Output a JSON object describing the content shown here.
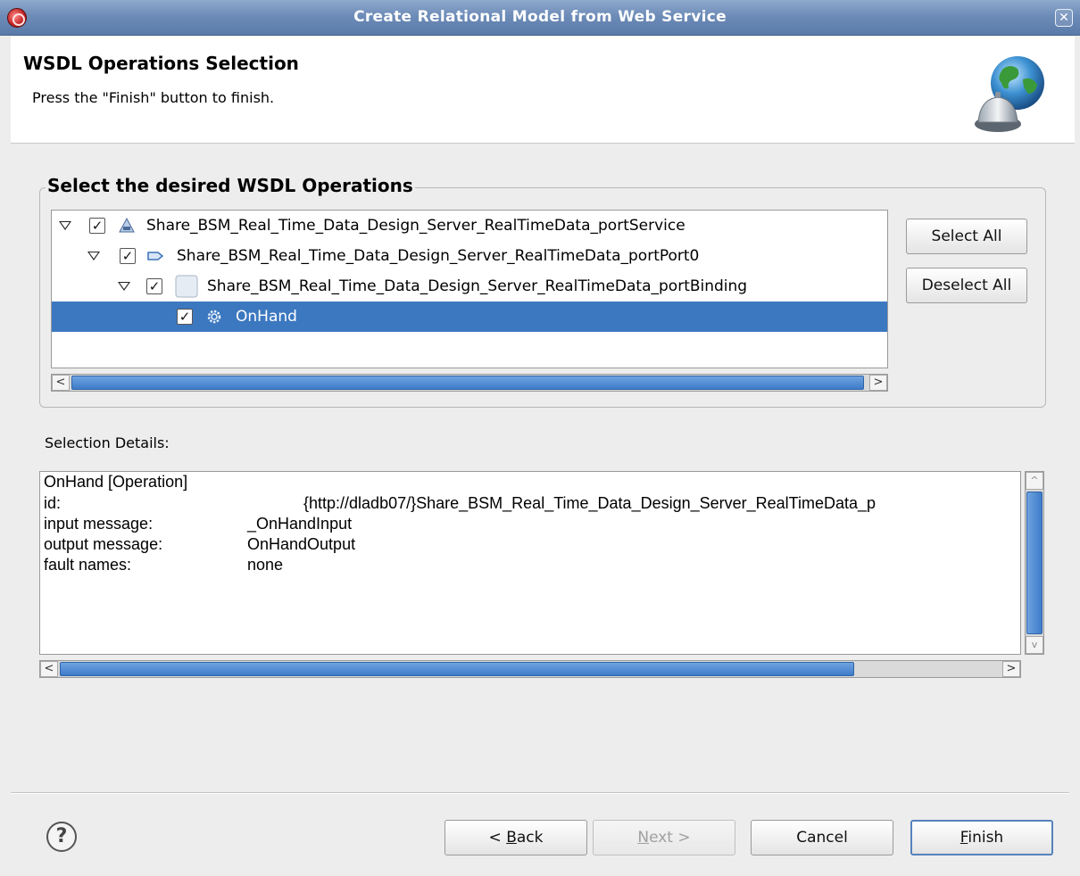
{
  "window": {
    "title": "Create Relational Model from Web Service",
    "close_glyph": "✕",
    "icon": "app-icon"
  },
  "header": {
    "title": "WSDL Operations Selection",
    "description": "Press the \"Finish\" button to finish.",
    "icon": "globe-service-bell-icon"
  },
  "operations_group": {
    "legend": "Select the desired WSDL Operations",
    "tree": [
      {
        "label": "Share_BSM_Real_Time_Data_Design_Server_RealTimeData_portService",
        "checked": true,
        "expanded": true,
        "icon": "service-icon"
      },
      {
        "label": "Share_BSM_Real_Time_Data_Design_Server_RealTimeData_portPort0",
        "checked": true,
        "expanded": true,
        "icon": "port-icon"
      },
      {
        "label": "Share_BSM_Real_Time_Data_Design_Server_RealTimeData_portBinding",
        "checked": true,
        "expanded": true,
        "icon": "binding-icon"
      },
      {
        "label": "OnHand",
        "checked": true,
        "selected": true,
        "icon": "operation-gear-icon"
      }
    ],
    "check_glyph": "✓",
    "select_all": "Select All",
    "deselect_all": "Deselect All"
  },
  "details": {
    "label": "Selection Details:",
    "heading": "OnHand [Operation]",
    "rows": [
      {
        "key": "id:",
        "value": "{http://dladb07/}Share_BSM_Real_Time_Data_Design_Server_RealTimeData_p"
      },
      {
        "key": "input message:",
        "value": "_OnHandInput"
      },
      {
        "key": "output message:",
        "value": "OnHandOutput"
      },
      {
        "key": "fault names:",
        "value": "none"
      }
    ]
  },
  "scroll_arrows": {
    "left": "<",
    "right": ">",
    "up": "^",
    "down": "v"
  },
  "footer": {
    "help": "?",
    "back_prefix": "< ",
    "back_mnemonic": "B",
    "back_rest": "ack",
    "next_mnemonic": "N",
    "next_rest": "ext >",
    "cancel": "Cancel",
    "finish_mnemonic": "F",
    "finish_rest": "inish"
  }
}
